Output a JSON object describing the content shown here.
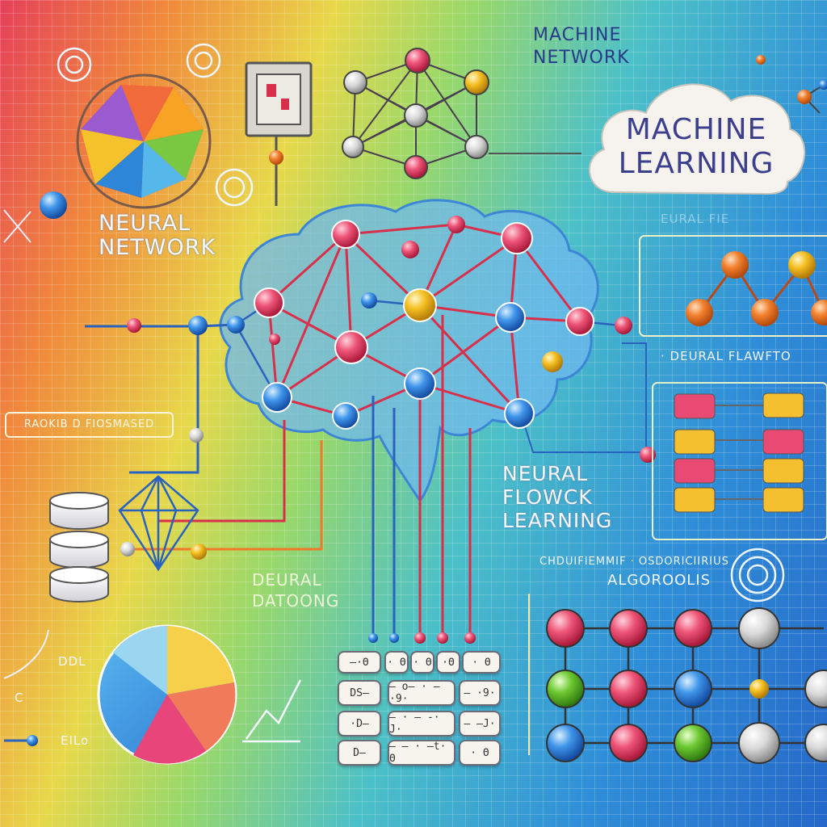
{
  "titles": {
    "machine_network": [
      "MACHINE",
      "NETWORK"
    ],
    "cloud_label": [
      "MACHINE",
      "LEARNING"
    ],
    "neural_network": [
      "NEURAL",
      "NETWORK"
    ],
    "neural_flowck": [
      "NEURAL",
      "FLOWCK",
      "LEARNING"
    ],
    "deural": [
      "DEURAL",
      "DATOONG"
    ],
    "neural_flawfo": "· DEURAL FLAWFTO",
    "algoroolis_top": "CHDUIFIEMMIF · OSDORICIIRIUS",
    "algoroolis": "ALGOROOLIS",
    "neural_faint": "EURAL FIE",
    "left_box": "RAOKIB D FIOSMASED",
    "ddl": "DDL",
    "ello": "EILo",
    "cc": "C"
  },
  "pills": [
    [
      "—·Θ",
      "· Θ",
      "· Θ",
      "·Θ",
      "· Θ"
    ],
    [
      "DS—",
      "— o— · —·9·",
      "— ·9·"
    ],
    [
      "·D—",
      "— · — -· J·",
      "— —J·"
    ],
    [
      "D—",
      "— — · —t· Θ",
      "· Θ"
    ]
  ],
  "colors": {
    "red_node": "#e84a6e",
    "blue_node": "#2f7fe0",
    "yellow_node": "#f0b520",
    "orange_node": "#ef7a2a",
    "wire_red": "#d8304a",
    "wire_blue": "#2060c8",
    "brain": "#5aa8e8",
    "cloud": "#f6f3ee",
    "cloud_text": "#3b3f8e"
  }
}
